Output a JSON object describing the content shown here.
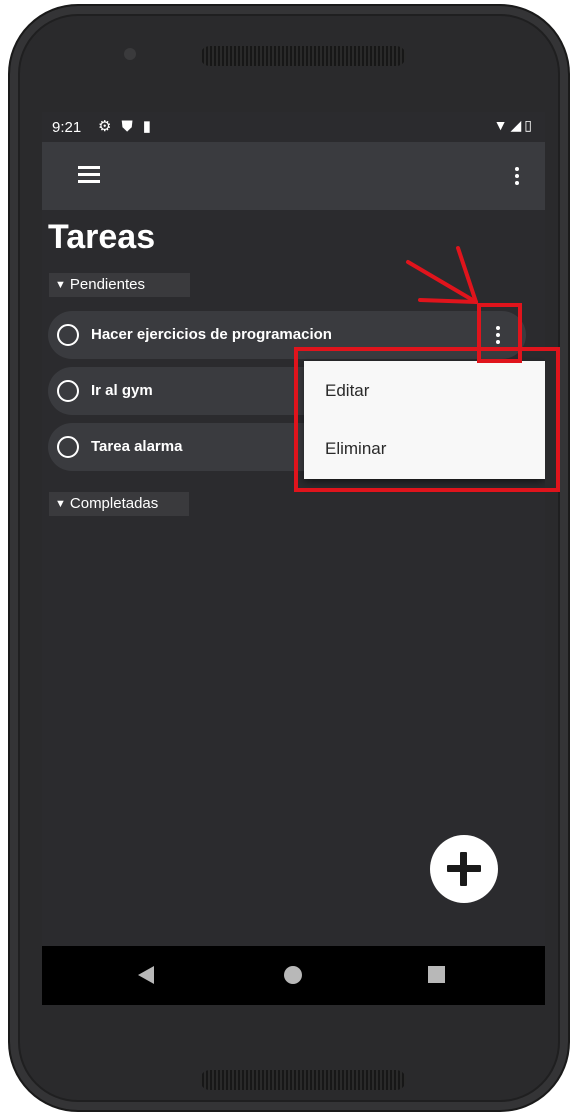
{
  "status_bar": {
    "time": "9:21",
    "left_icons": [
      "gear-icon",
      "shield-icon",
      "sd-card-icon"
    ],
    "right_icons": [
      "wifi-icon",
      "signal-icon",
      "battery-icon"
    ]
  },
  "app_bar": {
    "menu_icon": "hamburger-icon",
    "overflow_icon": "vertical-dots-icon"
  },
  "page": {
    "title": "Tareas"
  },
  "sections": {
    "pending": {
      "label": "Pendientes"
    },
    "completed": {
      "label": "Completadas"
    }
  },
  "tasks": [
    {
      "label": "Hacer ejercicios de programacion"
    },
    {
      "label": "Ir al gym"
    },
    {
      "label": "Tarea alarma"
    }
  ],
  "context_menu": {
    "edit": "Editar",
    "delete": "Eliminar"
  },
  "fab": {
    "icon": "plus-icon"
  },
  "nav_bar": {
    "icons": [
      "back-icon",
      "home-icon",
      "recents-icon"
    ]
  },
  "colors": {
    "screen_bg": "#2b2b2e",
    "appbar_bg": "#3a3b3f",
    "item_bg": "#3a3b3f",
    "menu_bg": "#f8f8f8",
    "annotation": "#e0141c"
  }
}
